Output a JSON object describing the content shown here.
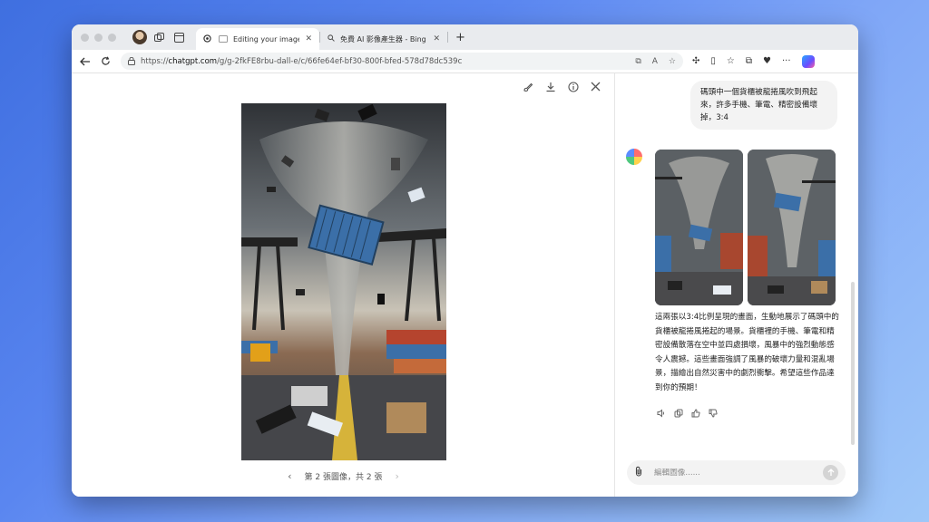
{
  "browser": {
    "tabs": [
      {
        "label": "Editing your images with DALL·E",
        "active": true
      },
      {
        "label": "免費 AI 影像產生器 - Bing 中的影像建立者",
        "active": false
      }
    ],
    "new_tab_symbol": "+",
    "url": {
      "scheme": "https://",
      "host": "chatgpt.com",
      "path": "/g/g-2fkFE8rbu-dall-e/c/66fe64ef-bf30-800f-bfed-578d78dc539c"
    }
  },
  "viewer": {
    "pager_text": "第 2 張圖像，共 2 張",
    "prev_symbol": "‹",
    "next_symbol": "›"
  },
  "chat": {
    "user_message": "碼頭中一個貨櫃被龍捲風吹到飛起來，許多手機、筆電、精密設備壞掉，3:4",
    "assistant_message": "這兩張以3:4比例呈現的畫面，生動地展示了碼頭中的貨櫃被龍捲風捲起的場景。貨櫃裡的手機、筆電和精密設備散落在空中並四處損壞，風暴中的強烈動態感令人震撼。這些畫面強調了風暴的破壞力量和混亂場景，描繪出自然災害中的劇烈衝擊。希望這些作品達到你的預期！",
    "composer_placeholder": "編輯圖像......"
  },
  "colors": {
    "container": "#3d6ea8",
    "desktop_start": "#3f6fe0",
    "desktop_end": "#9ec7f8"
  }
}
